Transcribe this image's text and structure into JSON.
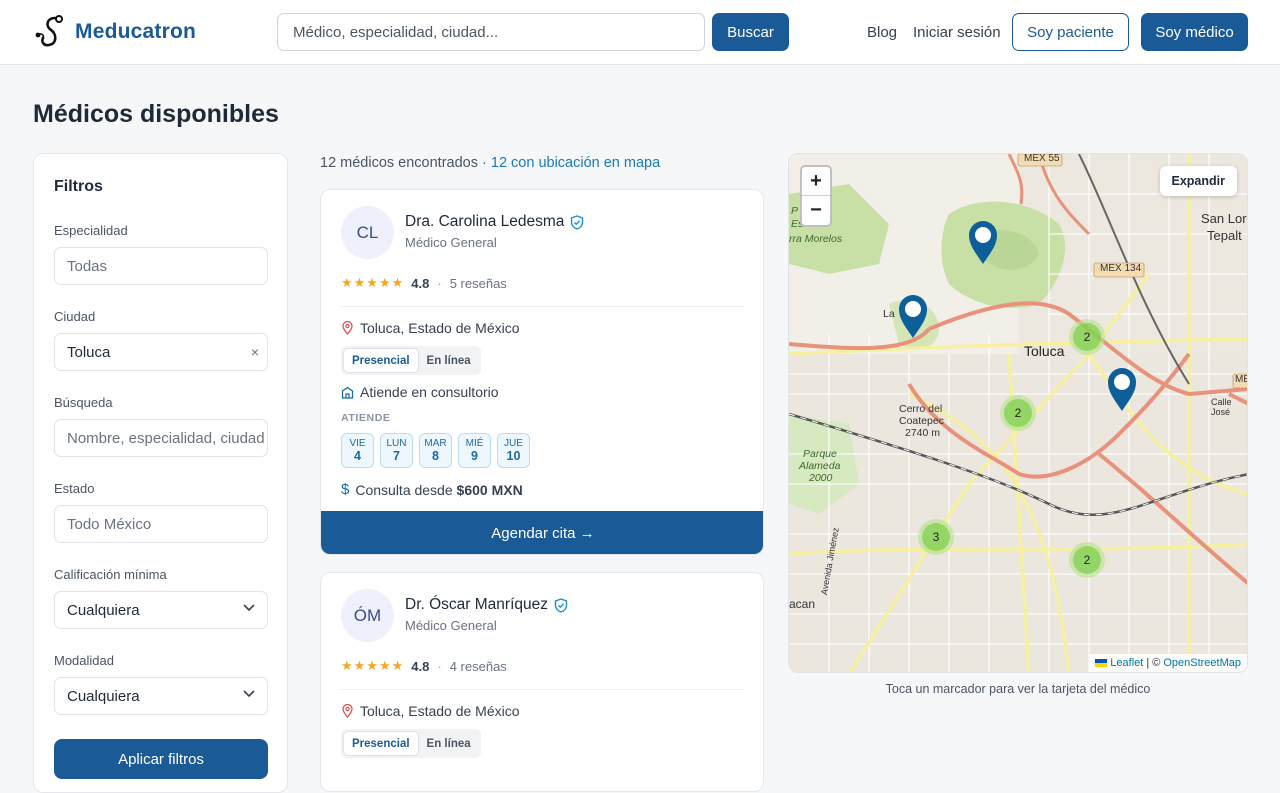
{
  "header": {
    "brand": "Meducatron",
    "search_placeholder": "Médico, especialidad, ciudad...",
    "search_button": "Buscar",
    "blog": "Blog",
    "login": "Iniciar sesión",
    "patient_button": "Soy paciente",
    "doctor_button": "Soy médico"
  },
  "page": {
    "title": "Médicos disponibles"
  },
  "filters": {
    "title": "Filtros",
    "specialty_label": "Especialidad",
    "specialty_value": "Todas",
    "city_label": "Ciudad",
    "city_value": "Toluca",
    "clear_glyph": "×",
    "search_label": "Búsqueda",
    "search_placeholder": "Nombre, especialidad, ciudad",
    "state_label": "Estado",
    "state_value": "Todo México",
    "rating_label": "Calificación mínima",
    "rating_value": "Cualquiera",
    "mode_label": "Modalidad",
    "mode_value": "Cualquiera",
    "apply_button": "Aplicar filtros"
  },
  "results": {
    "count_text": "12 médicos encontrados · ",
    "map_count_text": "12 con ubicación en mapa"
  },
  "doctors": [
    {
      "initials": "CL",
      "name": "Dra. Carolina Ledesma",
      "specialty": "Médico General",
      "stars": "★★★★★",
      "rating": "4.8",
      "sep": "·",
      "reviews": "5 reseñas",
      "location": "Toluca, Estado de México",
      "mode_presencial": "Presencial",
      "mode_online": "En línea",
      "office": "Atiende en consultorio",
      "attends_label": "ATIENDE",
      "days": [
        {
          "w": "VIE",
          "n": "4"
        },
        {
          "w": "LUN",
          "n": "7"
        },
        {
          "w": "MAR",
          "n": "8"
        },
        {
          "w": "MIÉ",
          "n": "9"
        },
        {
          "w": "JUE",
          "n": "10"
        }
      ],
      "price_prefix": "Consulta desde ",
      "price": "$600 MXN",
      "book_button": "Agendar cita →"
    },
    {
      "initials": "ÓM",
      "name": "Dr. Óscar Manríquez",
      "specialty": "Médico General",
      "stars": "★★★★★",
      "rating": "4.8",
      "sep": "·",
      "reviews": "4 reseñas",
      "location": "Toluca, Estado de México",
      "mode_presencial": "Presencial",
      "mode_online": "En línea"
    }
  ],
  "map": {
    "zoom_in": "+",
    "zoom_out": "−",
    "expand": "Expandir",
    "attribution_leaflet": "Leaflet",
    "attribution_sep": "| ©",
    "attribution_osm": "OpenStreetMap",
    "clusters": [
      "2",
      "2",
      "3",
      "2"
    ],
    "labels": {
      "toluca": "Toluca",
      "mex55": "MEX 55",
      "mex134": "MEX 134",
      "sanlo": "San Lor",
      "tepalt": "Tepalt",
      "coatepec": "Cerro del",
      "coatepec2": "Coatepec",
      "coatepec3": "2740 m",
      "parque": "Parque",
      "alameda": "Alameda",
      "y2000": "2000",
      "calle": "Calle José",
      "acan": "acan",
      "avenida": "Avenida Jiménez",
      "estatal": "Estatal",
      "morelos": "rra Morelos",
      "p": "P",
      "la": "La",
      "mex": "ME"
    },
    "colors": {
      "park": "#c8dfa6",
      "road_major": "#e8927c",
      "road_minor": "#f6f0a0"
    },
    "caption": "Toca un marcador para ver la tarjeta del médico"
  }
}
